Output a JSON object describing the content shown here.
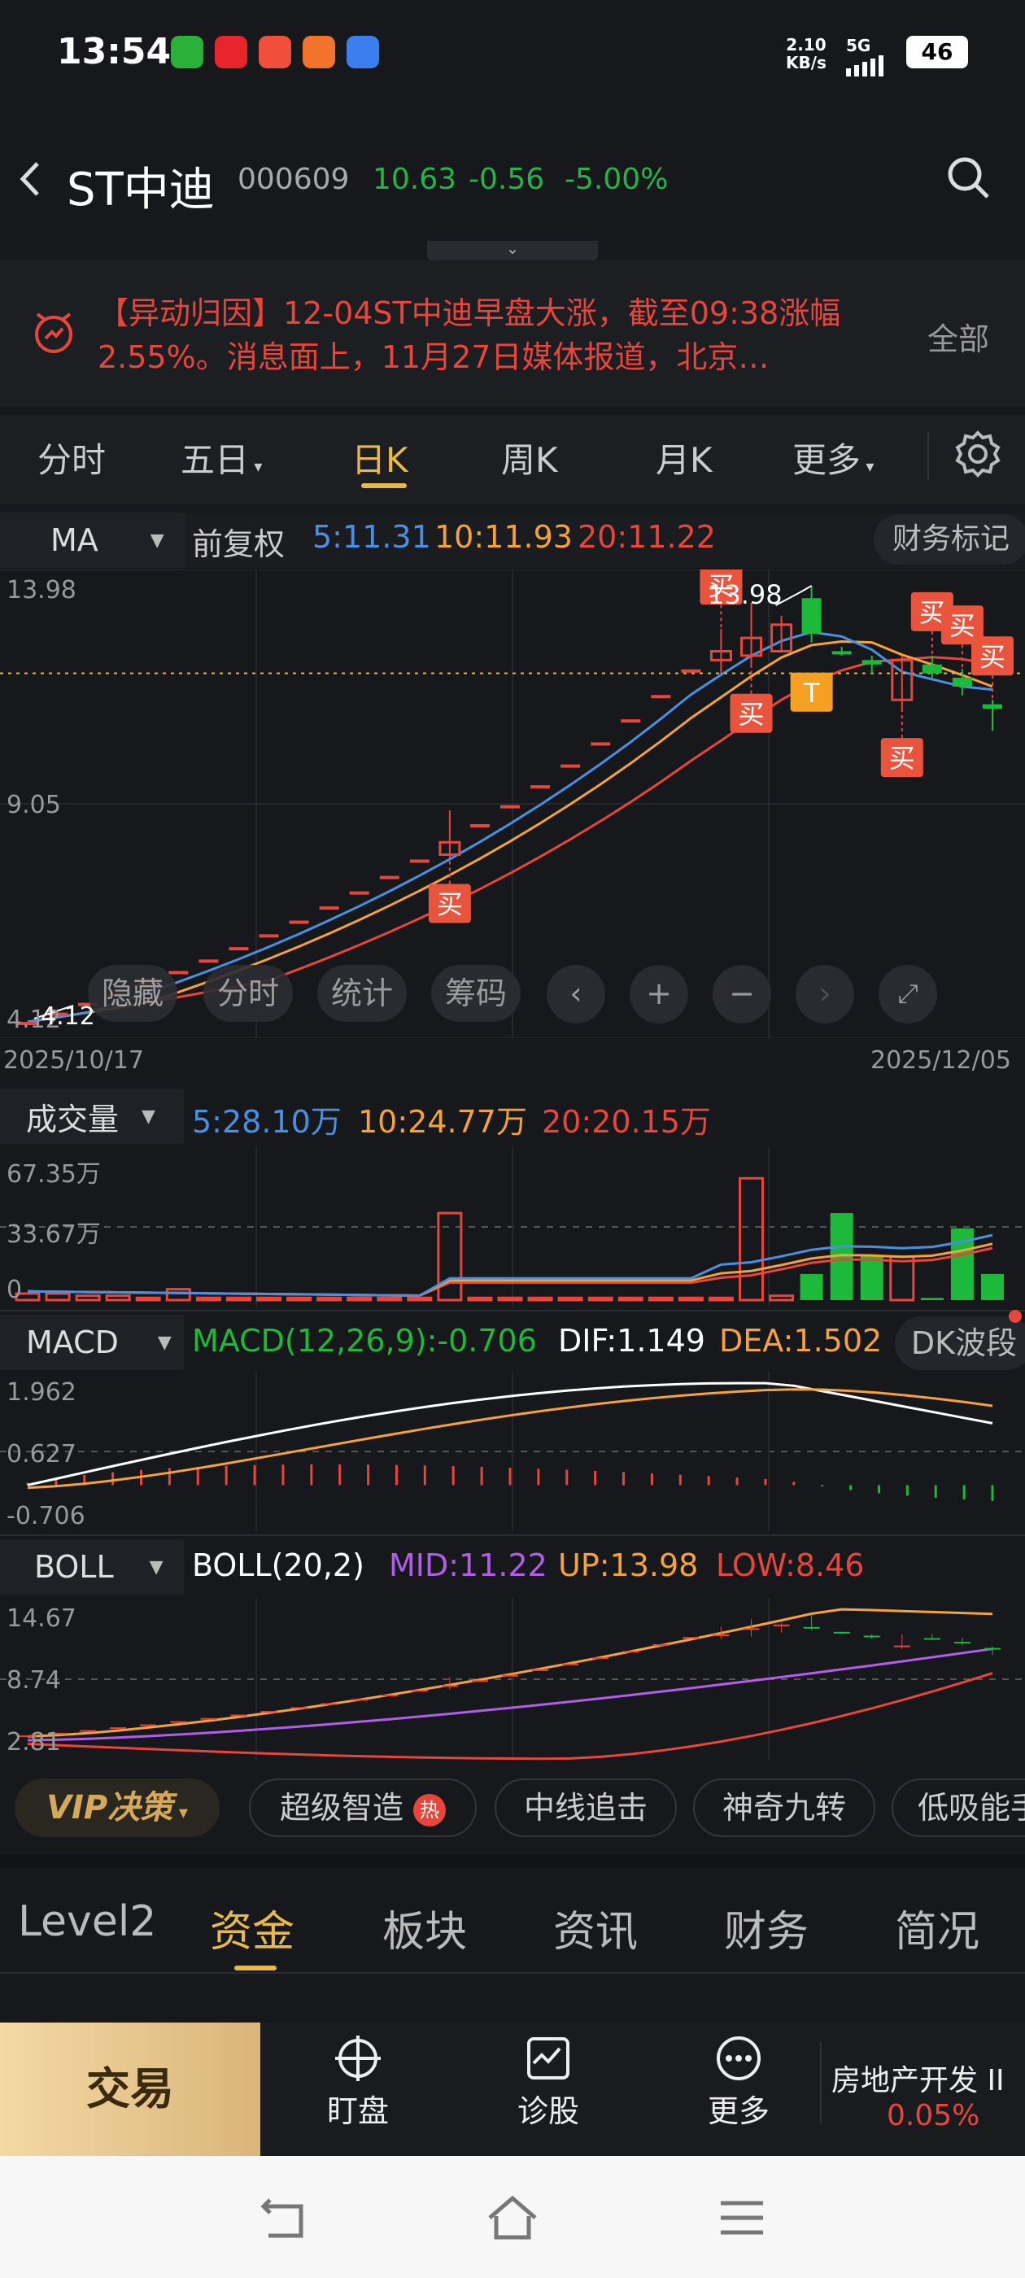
{
  "status_bar": {
    "time": "13:54",
    "net_speed_value": "2.10",
    "net_speed_unit": "KB/s",
    "network": "5G",
    "battery": "46"
  },
  "header": {
    "back_icon": "chevron-left-icon",
    "name": "ST中迪",
    "code": "000609",
    "price": "10.63",
    "change": "-0.56",
    "change_pct": "-5.00%",
    "search_icon": "search-icon"
  },
  "news": {
    "text": "【异动归因】12-04ST中迪早盘大涨，截至09:38涨幅2.55%。消息面上，11月27日媒体报道，北京…",
    "all_label": "全部"
  },
  "kline_tabs": {
    "items": [
      "分时",
      "五日",
      "日K",
      "周K",
      "月K",
      "更多"
    ],
    "active": "日K"
  },
  "ma_line": {
    "name": "MA",
    "adjust": "前复权",
    "ma5": "5:11.31",
    "ma10": "10:11.93",
    "ma20": "20:11.22",
    "finance_mark": "财务标记"
  },
  "colors": {
    "ma5": "#4a90e2",
    "ma10": "#f5a23a",
    "ma20": "#e8453c",
    "up": "#e8453c",
    "down": "#1db93a",
    "accent": "#e8b94b",
    "purple": "#b05ee8"
  },
  "price_axis": {
    "top": "13.98",
    "mid": "9.05",
    "low": "4.12"
  },
  "date_axis": {
    "start": "2025/10/17",
    "end": "2025/12/05"
  },
  "annotations": {
    "high": "13.98",
    "low": "4.12",
    "buy": "买",
    "t": "T"
  },
  "chart_controls": {
    "hide": "隐藏",
    "intraday": "分时",
    "stats": "统计",
    "chips": "筹码"
  },
  "volume": {
    "name": "成交量",
    "ma5": "5:28.10万",
    "ma10": "10:24.77万",
    "ma20": "20:20.15万",
    "axis_top": "67.35万",
    "axis_mid": "33.67万",
    "axis_low": "0"
  },
  "macd": {
    "name": "MACD",
    "params": "MACD(12,26,9):-0.706",
    "dif": "DIF:1.149",
    "dea": "DEA:1.502",
    "dk": "DK波段",
    "axis_top": "1.962",
    "axis_mid": "0.627",
    "axis_low": "-0.706"
  },
  "boll": {
    "name": "BOLL",
    "params": "BOLL(20,2)",
    "mid": "MID:11.22",
    "up": "UP:13.98",
    "low": "LOW:8.46",
    "axis_top": "14.67",
    "axis_mid": "8.74",
    "axis_low": "2.81"
  },
  "features": {
    "vip": "VIP决策",
    "items": [
      "超级智造",
      "中线追击",
      "神奇九转",
      "低吸能手"
    ],
    "hot": "热"
  },
  "bottom_tabs": {
    "items": [
      "Level2",
      "资金",
      "板块",
      "资讯",
      "财务",
      "简况"
    ],
    "active": "资金"
  },
  "bottom_bar": {
    "trade": "交易",
    "watch": "盯盘",
    "diagnose": "诊股",
    "more": "更多",
    "sector": "房地产开发 II",
    "sector_pct": "0.05%"
  },
  "chart_data": [
    {
      "type": "candlestick",
      "title": "日K",
      "x_range": [
        "2025/10/17",
        "2025/12/05"
      ],
      "ylim": [
        4.12,
        13.98
      ],
      "candles": [
        {
          "o": 4.12,
          "c": 4.12,
          "h": 4.12,
          "l": 4.12,
          "dir": "up"
        },
        {
          "o": 4.33,
          "c": 4.33,
          "h": 4.33,
          "l": 4.33,
          "dir": "up"
        },
        {
          "o": 4.55,
          "c": 4.55,
          "h": 4.55,
          "l": 4.55,
          "dir": "up"
        },
        {
          "o": 4.78,
          "c": 4.78,
          "h": 4.78,
          "l": 4.78,
          "dir": "up"
        },
        {
          "o": 5.02,
          "c": 5.02,
          "h": 5.02,
          "l": 5.02,
          "dir": "up"
        },
        {
          "o": 5.27,
          "c": 5.27,
          "h": 5.27,
          "l": 5.27,
          "dir": "up"
        },
        {
          "o": 5.53,
          "c": 5.53,
          "h": 5.53,
          "l": 5.53,
          "dir": "up"
        },
        {
          "o": 5.81,
          "c": 5.81,
          "h": 5.81,
          "l": 5.81,
          "dir": "up"
        },
        {
          "o": 6.1,
          "c": 6.1,
          "h": 6.1,
          "l": 6.1,
          "dir": "up"
        },
        {
          "o": 6.41,
          "c": 6.41,
          "h": 6.41,
          "l": 6.41,
          "dir": "up"
        },
        {
          "o": 6.73,
          "c": 6.73,
          "h": 6.73,
          "l": 6.73,
          "dir": "up"
        },
        {
          "o": 7.07,
          "c": 7.07,
          "h": 7.07,
          "l": 7.07,
          "dir": "up"
        },
        {
          "o": 7.42,
          "c": 7.42,
          "h": 7.42,
          "l": 7.42,
          "dir": "up"
        },
        {
          "o": 7.79,
          "c": 7.79,
          "h": 7.79,
          "l": 7.79,
          "dir": "up"
        },
        {
          "o": 7.9,
          "c": 8.18,
          "h": 8.9,
          "l": 7.9,
          "dir": "up"
        },
        {
          "o": 8.59,
          "c": 8.59,
          "h": 8.59,
          "l": 8.59,
          "dir": "up"
        },
        {
          "o": 9.02,
          "c": 9.02,
          "h": 9.02,
          "l": 9.02,
          "dir": "up"
        },
        {
          "o": 9.47,
          "c": 9.47,
          "h": 9.47,
          "l": 9.47,
          "dir": "up"
        },
        {
          "o": 9.94,
          "c": 9.94,
          "h": 9.94,
          "l": 9.94,
          "dir": "up"
        },
        {
          "o": 10.44,
          "c": 10.44,
          "h": 10.44,
          "l": 10.44,
          "dir": "up"
        },
        {
          "o": 10.96,
          "c": 10.96,
          "h": 10.96,
          "l": 10.96,
          "dir": "up"
        },
        {
          "o": 11.51,
          "c": 11.51,
          "h": 11.51,
          "l": 11.51,
          "dir": "up"
        },
        {
          "o": 12.09,
          "c": 12.09,
          "h": 12.09,
          "l": 12.09,
          "dir": "up"
        },
        {
          "o": 12.5,
          "c": 12.3,
          "h": 13.0,
          "l": 12.0,
          "dir": "up"
        },
        {
          "o": 12.4,
          "c": 12.8,
          "h": 13.6,
          "l": 12.2,
          "dir": "up"
        },
        {
          "o": 12.5,
          "c": 13.1,
          "h": 13.3,
          "l": 12.5,
          "dir": "up"
        },
        {
          "o": 13.7,
          "c": 12.9,
          "h": 13.98,
          "l": 12.7,
          "dir": "down"
        },
        {
          "o": 12.5,
          "c": 12.5,
          "h": 12.6,
          "l": 12.4,
          "dir": "down"
        },
        {
          "o": 12.3,
          "c": 12.2,
          "h": 12.4,
          "l": 12.0,
          "dir": "down"
        },
        {
          "o": 12.3,
          "c": 11.4,
          "h": 12.4,
          "l": 11.2,
          "dir": "up"
        },
        {
          "o": 12.2,
          "c": 12.0,
          "h": 12.4,
          "l": 11.9,
          "dir": "down"
        },
        {
          "o": 11.9,
          "c": 11.7,
          "h": 12.1,
          "l": 11.5,
          "dir": "down"
        },
        {
          "o": 11.3,
          "c": 11.2,
          "h": 11.4,
          "l": 10.7,
          "dir": "down"
        }
      ]
    },
    {
      "type": "bar",
      "title": "成交量",
      "ylim": [
        0,
        67.35
      ],
      "values": [
        3,
        3,
        2,
        2,
        1,
        5,
        1,
        1,
        1,
        1,
        1,
        1,
        1,
        1,
        40,
        1,
        1,
        1,
        1,
        1,
        1,
        1,
        1,
        1,
        56,
        2,
        12,
        40,
        20,
        20,
        1,
        33,
        12,
        22,
        25
      ],
      "colors_by": "candle direction"
    },
    {
      "type": "bar",
      "title": "MACD",
      "ylim": [
        -0.706,
        1.962
      ],
      "dif_last": 1.149,
      "dea_last": 1.502,
      "hist_last": -0.706
    },
    {
      "type": "line",
      "title": "BOLL",
      "ylim": [
        2.81,
        14.67
      ],
      "mid_last": 11.22,
      "up_last": 13.98,
      "low_last": 8.46
    }
  ]
}
